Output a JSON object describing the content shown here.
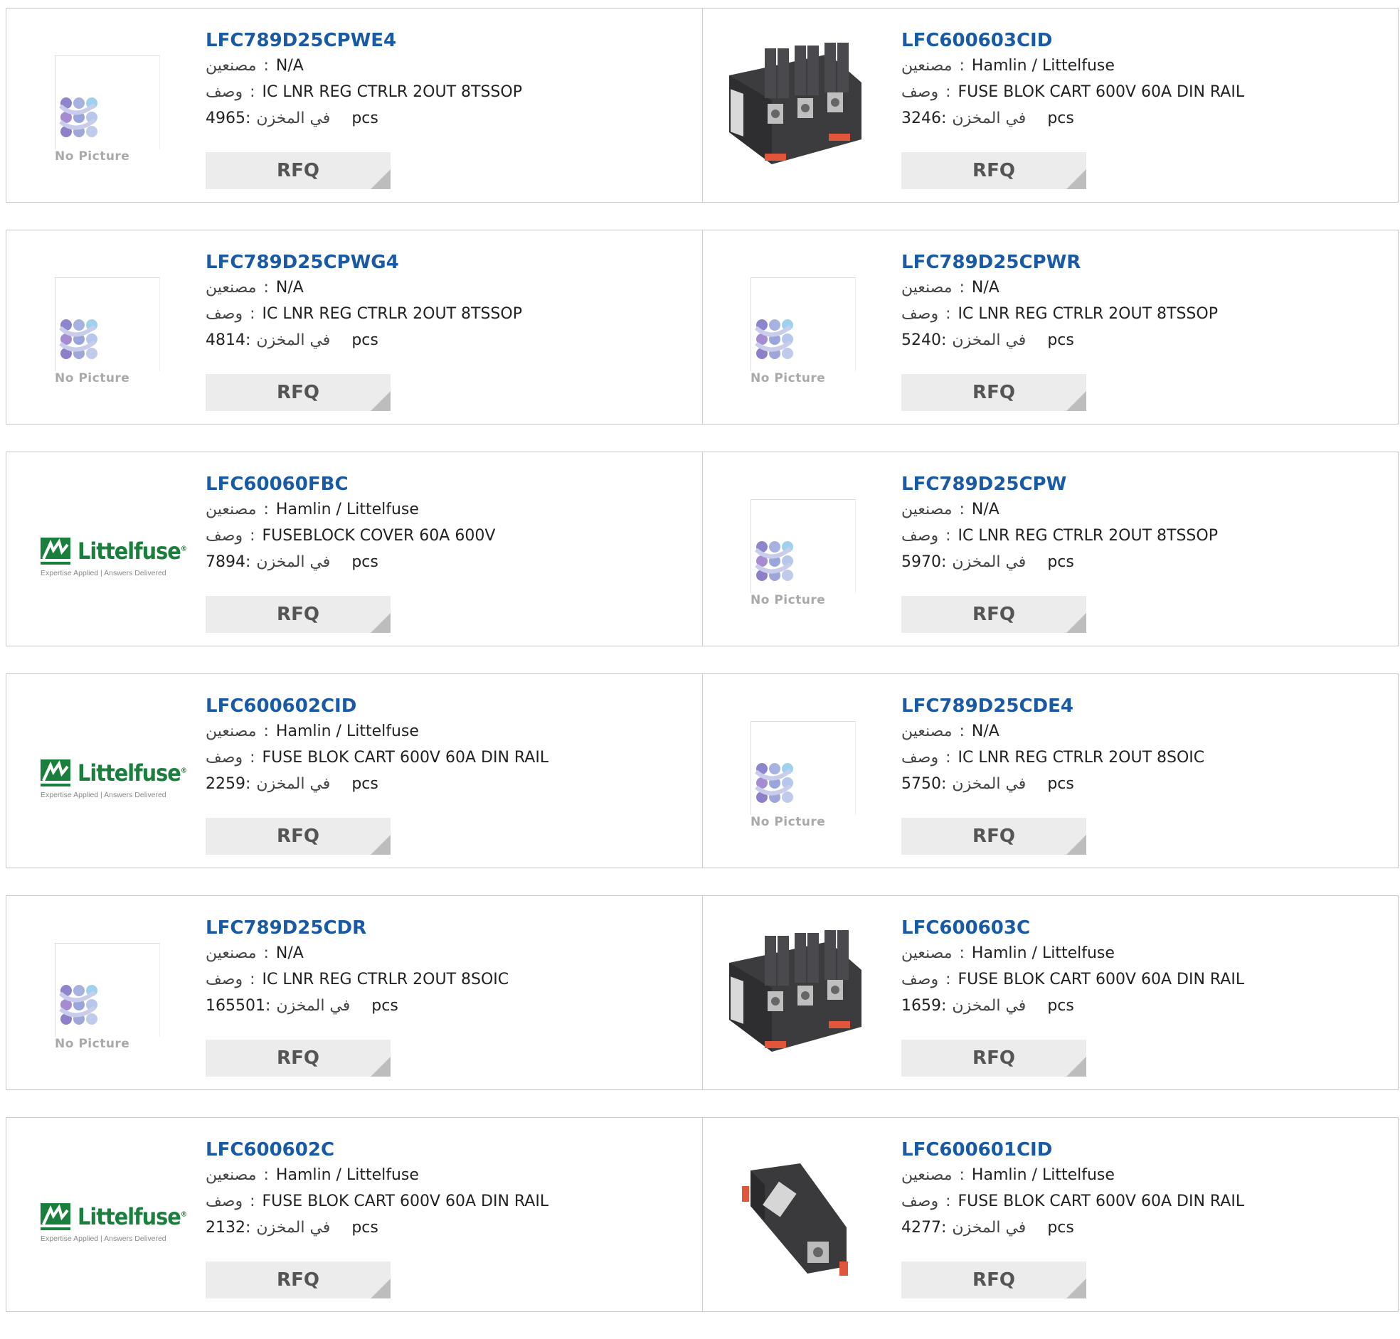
{
  "labels": {
    "manufacturer": "مصنعين",
    "description": "وصف",
    "stock": "في المخزن",
    "pcs": "pcs",
    "rfq": "RFQ",
    "no_picture": "No Picture",
    "logo_word": "Littelfuse",
    "logo_tagline": "Expertise Applied | Answers Delivered"
  },
  "colors": {
    "title_link": "#1a5aa5",
    "rfq_bg": "#ececec",
    "littelfuse_green": "#1a7f3c"
  },
  "products": [
    {
      "part": "LFC789D25CPWE4",
      "manufacturer": "N/A",
      "description": "IC LNR REG CTRLR 2OUT 8TSSOP",
      "stock": "4965",
      "image": "no-picture"
    },
    {
      "part": "LFC600603CID",
      "manufacturer": "Hamlin / Littelfuse",
      "description": "FUSE BLOK CART 600V 60A DIN RAIL",
      "stock": "3246",
      "image": "fuse-block-3pole"
    },
    {
      "part": "LFC789D25CPWG4",
      "manufacturer": "N/A",
      "description": "IC LNR REG CTRLR 2OUT 8TSSOP",
      "stock": "4814",
      "image": "no-picture"
    },
    {
      "part": "LFC789D25CPWR",
      "manufacturer": "N/A",
      "description": "IC LNR REG CTRLR 2OUT 8TSSOP",
      "stock": "5240",
      "image": "no-picture"
    },
    {
      "part": "LFC60060FBC",
      "manufacturer": "Hamlin / Littelfuse",
      "description": "FUSEBLOCK COVER 60A 600V",
      "stock": "7894",
      "image": "littelfuse-logo"
    },
    {
      "part": "LFC789D25CPW",
      "manufacturer": "N/A",
      "description": "IC LNR REG CTRLR 2OUT 8TSSOP",
      "stock": "5970",
      "image": "no-picture"
    },
    {
      "part": "LFC600602CID",
      "manufacturer": "Hamlin / Littelfuse",
      "description": "FUSE BLOK CART 600V 60A DIN RAIL",
      "stock": "2259",
      "image": "littelfuse-logo"
    },
    {
      "part": "LFC789D25CDE4",
      "manufacturer": "N/A",
      "description": "IC LNR REG CTRLR 2OUT 8SOIC",
      "stock": "5750",
      "image": "no-picture"
    },
    {
      "part": "LFC789D25CDR",
      "manufacturer": "N/A",
      "description": "IC LNR REG CTRLR 2OUT 8SOIC",
      "stock": "165501",
      "image": "no-picture"
    },
    {
      "part": "LFC600603C",
      "manufacturer": "Hamlin / Littelfuse",
      "description": "FUSE BLOK CART 600V 60A DIN RAIL",
      "stock": "1659",
      "image": "fuse-block-3pole"
    },
    {
      "part": "LFC600602C",
      "manufacturer": "Hamlin / Littelfuse",
      "description": "FUSE BLOK CART 600V 60A DIN RAIL",
      "stock": "2132",
      "image": "littelfuse-logo"
    },
    {
      "part": "LFC600601CID",
      "manufacturer": "Hamlin / Littelfuse",
      "description": "FUSE BLOK CART 600V 60A DIN RAIL",
      "stock": "4277",
      "image": "fuse-block-1pole"
    }
  ]
}
